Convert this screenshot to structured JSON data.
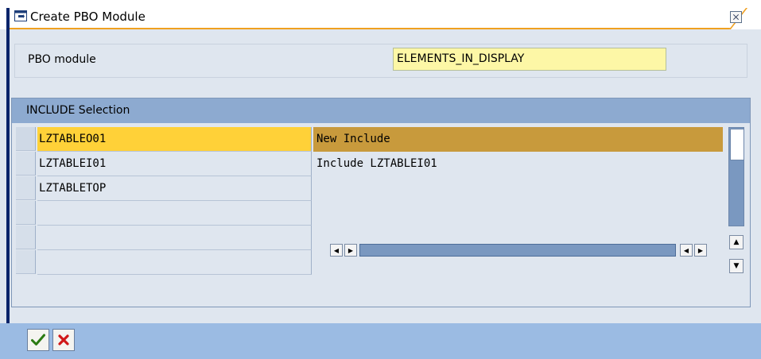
{
  "dialog": {
    "title": "Create PBO Module",
    "close_icon": "close-icon"
  },
  "pbo": {
    "label": "PBO module",
    "value": "ELEMENTS_IN_DISPLAY"
  },
  "include": {
    "title": "INCLUDE Selection",
    "rows": [
      {
        "name": "LZTABLEO01",
        "description": "New Include",
        "selected": true
      },
      {
        "name": "LZTABLEI01",
        "description": "Include LZTABLEI01",
        "selected": false
      },
      {
        "name": "LZTABLETOP",
        "description": "",
        "selected": false
      },
      {
        "name": "",
        "description": "",
        "selected": false
      },
      {
        "name": "",
        "description": "",
        "selected": false
      },
      {
        "name": "",
        "description": "",
        "selected": false
      }
    ]
  },
  "toolbar": {
    "ok_icon": "checkmark-icon",
    "cancel_icon": "cancel-x-icon"
  },
  "colors": {
    "selected_name": "#ffd138",
    "selected_desc": "#c89a3c",
    "header_blue": "#8daad0",
    "toolbar_blue": "#9bbbe3",
    "input_yellow": "#fdf7a6"
  }
}
